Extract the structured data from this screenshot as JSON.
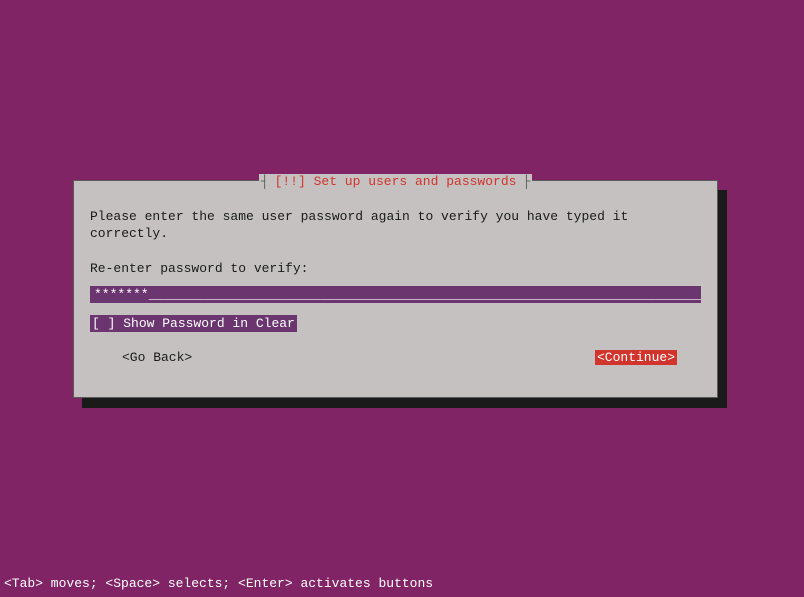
{
  "dialog": {
    "title_prefix": "[!!]",
    "title": "Set up users and passwords",
    "instruction": "Please enter the same user password again to verify you have typed it correctly.",
    "field_label": "Re-enter password to verify:",
    "password_display": "*******_________________________________________________________________________",
    "checkbox": {
      "state": "[ ]",
      "label": "Show Password in Clear"
    },
    "buttons": {
      "back": "<Go Back>",
      "continue": "<Continue>"
    }
  },
  "footer": {
    "hint": "<Tab> moves; <Space> selects; <Enter> activates buttons"
  }
}
